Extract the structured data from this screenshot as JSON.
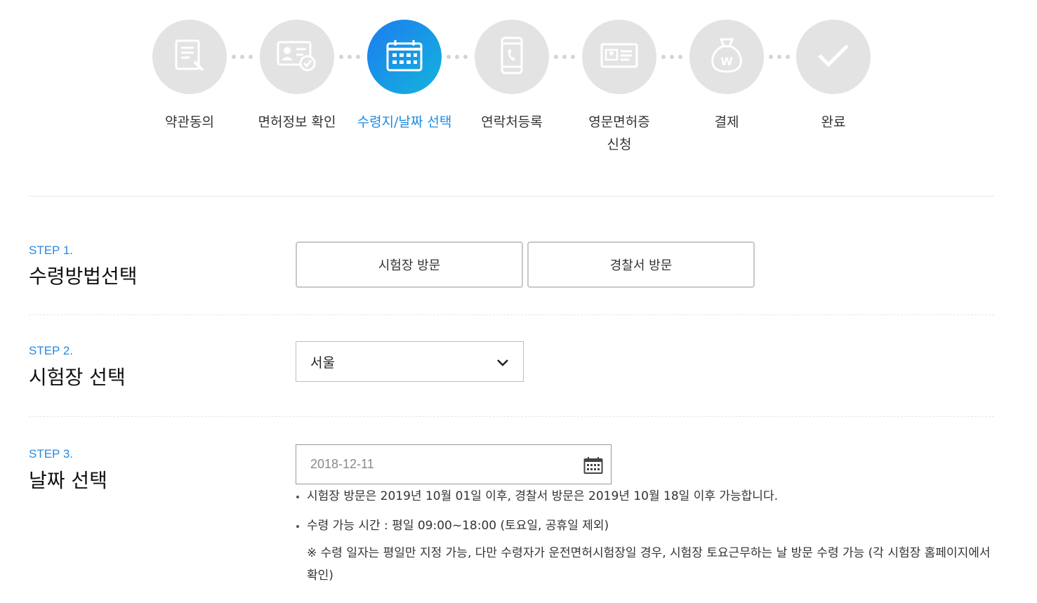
{
  "steps": [
    {
      "label": "약관동의",
      "icon": "document-pen-icon"
    },
    {
      "label": "면허정보 확인",
      "icon": "id-card-check-icon"
    },
    {
      "label": "수령지/날짜 선택",
      "icon": "calendar-icon"
    },
    {
      "label": "연락처등록",
      "icon": "phone-icon"
    },
    {
      "label": "영문면허증",
      "label2": "신청",
      "icon": "license-card-icon"
    },
    {
      "label": "결제",
      "icon": "won-bag-icon"
    },
    {
      "label": "완료",
      "icon": "check-icon"
    }
  ],
  "active_step": 2,
  "colors": {
    "accent": "#1b8be0",
    "inactive": "#e3e3e3"
  },
  "step1": {
    "tag": "STEP 1.",
    "title": "수령방법선택",
    "options": [
      "시험장 방문",
      "경찰서 방문"
    ]
  },
  "step2": {
    "tag": "STEP 2.",
    "title": "시험장 선택",
    "selected": "서울"
  },
  "step3": {
    "tag": "STEP 3.",
    "title": "날짜 선택",
    "date_value": "2018-12-11",
    "notes": [
      "시험장 방문은 2019년 10월 01일 이후, 경찰서 방문은 2019년 10월 18일 이후 가능합니다.",
      "수령 가능 시간 : 평일 09:00~18:00 (토요일, 공휴일 제외)"
    ],
    "remark": "※ 수령 일자는 평일만 지정 가능, 다만 수령자가 운전면허시험장일 경우, 시험장 토요근무하는 날 방문 수령 가능 (각 시험장 홈페이지에서 확인)"
  }
}
